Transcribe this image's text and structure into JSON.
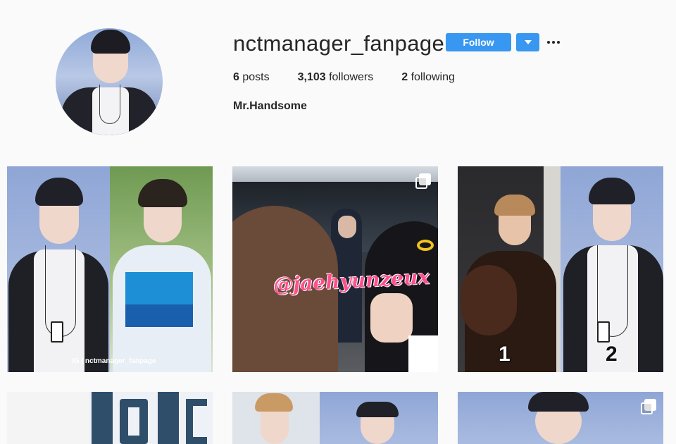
{
  "profile": {
    "username": "nctmanager_fanpage",
    "follow_label": "Follow",
    "posts_count": "6",
    "posts_label": "posts",
    "followers_count": "3,103",
    "followers_label": "followers",
    "following_count": "2",
    "following_label": "following",
    "full_name": "Mr.Handsome"
  },
  "posts": [
    {
      "caption": "IG | nctmanager_fanpage",
      "multi": false
    },
    {
      "watermark": "@jaehyunzeux",
      "multi": true
    },
    {
      "labels": [
        "1",
        "2"
      ],
      "multi": false
    },
    {
      "multi": false
    },
    {
      "multi": false
    },
    {
      "multi": true
    }
  ],
  "colors": {
    "accent": "#3897f0",
    "background": "#fafafa"
  }
}
